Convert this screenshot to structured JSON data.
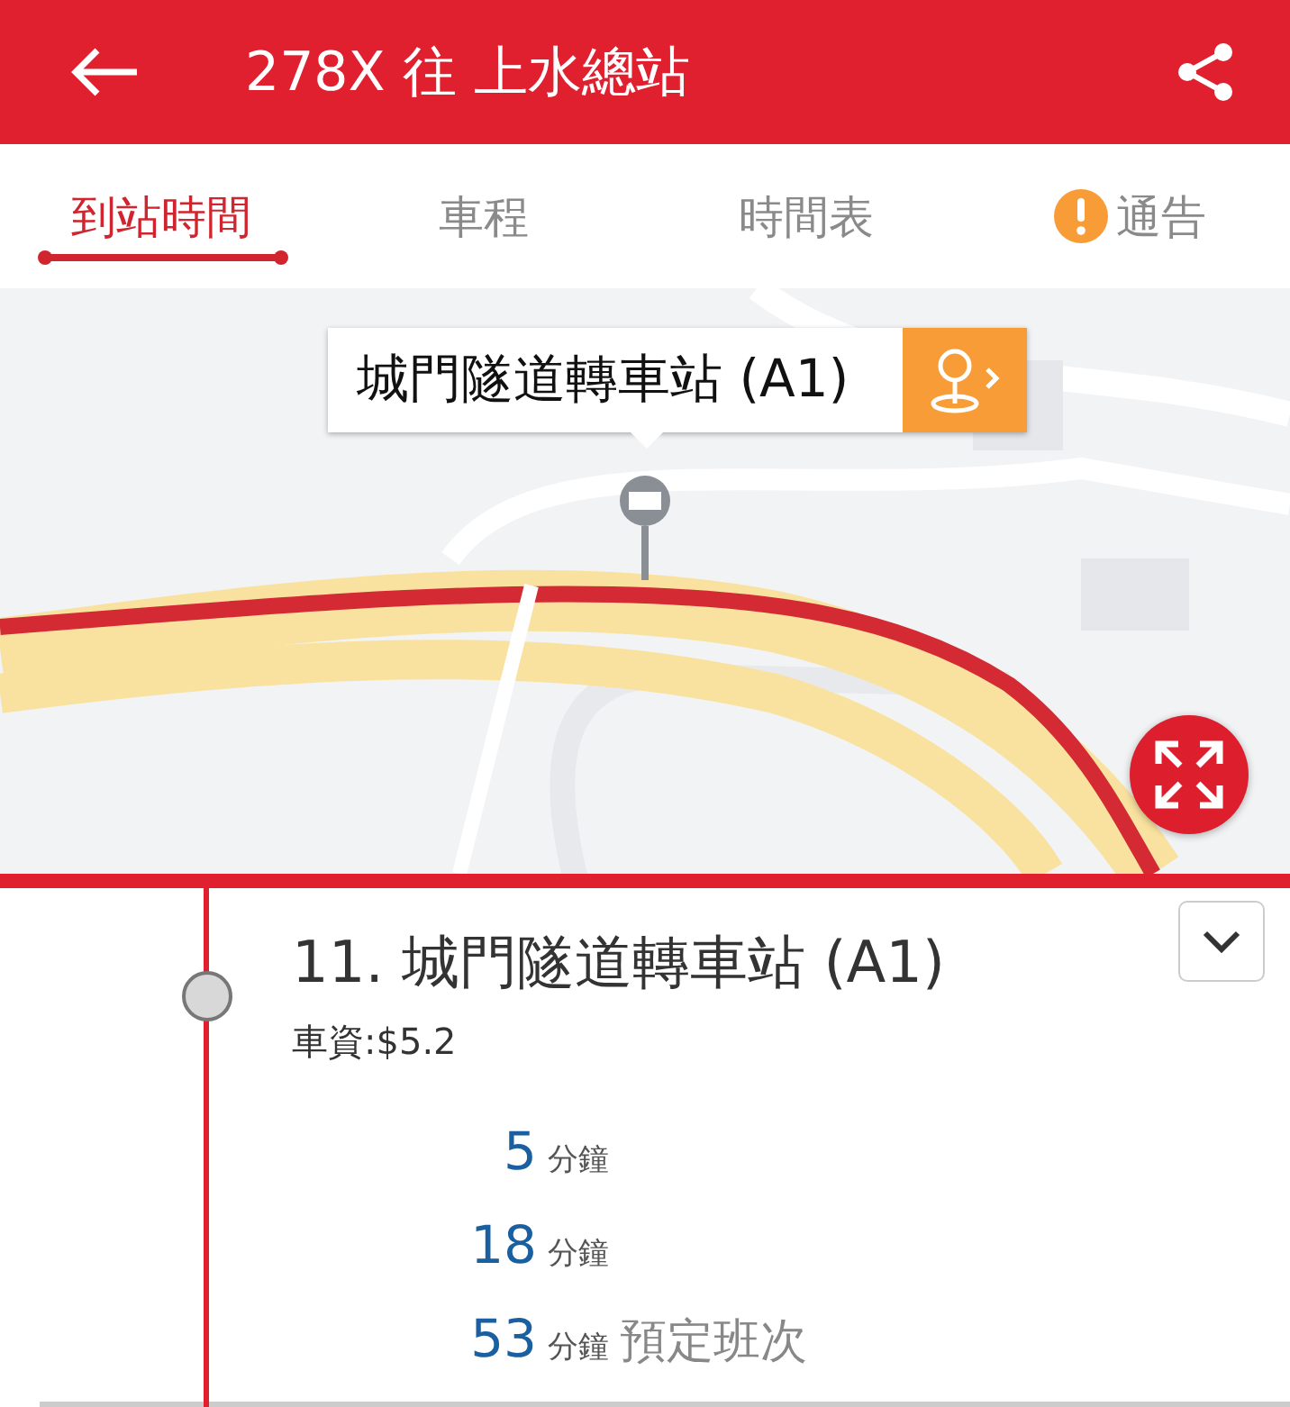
{
  "header": {
    "title": "278X 往 上水總站"
  },
  "tabs": [
    {
      "label": "到站時間",
      "selected": true,
      "kind": "plain"
    },
    {
      "label": "車程",
      "selected": false,
      "kind": "plain"
    },
    {
      "label": "時間表",
      "selected": false,
      "kind": "plain"
    },
    {
      "label": "通告",
      "selected": false,
      "kind": "alert"
    }
  ],
  "map": {
    "kind": "picture",
    "info_window": {
      "title": "城門隧道轉車站 (A1)"
    }
  },
  "stop": {
    "name": "11. 城門隧道轉車站 (A1)",
    "fare": "車資:$5.2",
    "etas": [
      {
        "minutes": "5",
        "unit": "分鐘"
      },
      {
        "minutes": "18",
        "unit": "分鐘"
      },
      {
        "minutes": "53",
        "unit": "分鐘",
        "note": "預定班次"
      }
    ]
  }
}
